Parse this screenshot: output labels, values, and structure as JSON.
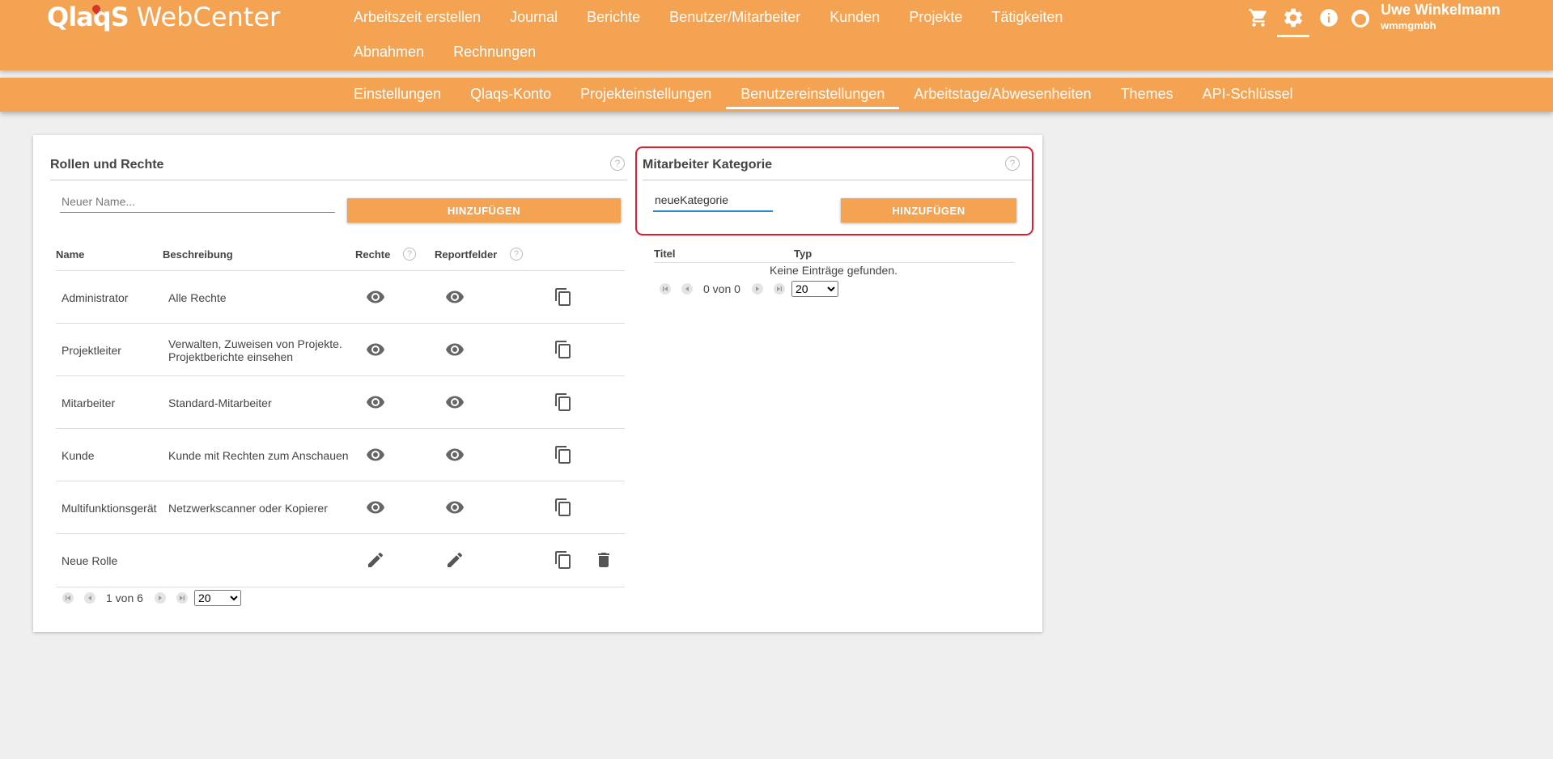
{
  "app": {
    "logo_mark": "QlaqS",
    "logo_text": "WebCenter"
  },
  "main_nav": [
    {
      "label": "Arbeitszeit erstellen"
    },
    {
      "label": "Journal"
    },
    {
      "label": "Berichte"
    },
    {
      "label": "Benutzer/Mitarbeiter"
    },
    {
      "label": "Kunden"
    },
    {
      "label": "Projekte"
    },
    {
      "label": "Tätigkeiten"
    },
    {
      "label": "Abnahmen"
    },
    {
      "label": "Rechnungen"
    }
  ],
  "header_icons": [
    "cart-icon",
    "gear-icon",
    "info-icon",
    "user-avatar-icon"
  ],
  "user": {
    "name": "Uwe Winkelmann",
    "company": "wmmgmbh"
  },
  "sub_nav": [
    {
      "label": "Einstellungen"
    },
    {
      "label": "Qlaqs-Konto"
    },
    {
      "label": "Projekteinstellungen"
    },
    {
      "label": "Benutzereinstellungen",
      "active": true
    },
    {
      "label": "Arbeitstage/Abwesenheiten"
    },
    {
      "label": "Themes"
    },
    {
      "label": "API-Schlüssel"
    }
  ],
  "roles": {
    "title": "Rollen und Rechte",
    "input_placeholder": "Neuer Name...",
    "input_value": "",
    "add_label": "HINZUFÜGEN",
    "columns": {
      "name": "Name",
      "description": "Beschreibung",
      "rights": "Rechte",
      "report_fields": "Reportfelder"
    },
    "rows": [
      {
        "name": "Administrator",
        "description": "Alle Rechte",
        "mode": "view",
        "deletable": false
      },
      {
        "name": "Projektleiter",
        "description": "Verwalten, Zuweisen von Projekte. Projektberichte einsehen",
        "mode": "view",
        "deletable": false
      },
      {
        "name": "Mitarbeiter",
        "description": "Standard-Mitarbeiter",
        "mode": "view",
        "deletable": false
      },
      {
        "name": "Kunde",
        "description": "Kunde mit Rechten zum Anschauen",
        "mode": "view",
        "deletable": false
      },
      {
        "name": "Multifunktionsgerät",
        "description": "Netzwerkscanner oder Kopierer",
        "mode": "view",
        "deletable": false
      },
      {
        "name": "Neue Rolle",
        "description": "",
        "mode": "edit",
        "deletable": true
      }
    ],
    "pager": {
      "text": "1 von 6",
      "page_size": "20",
      "page_size_options": [
        "20"
      ]
    }
  },
  "categories": {
    "title": "Mitarbeiter Kategorie",
    "input_value": "neueKategorie",
    "add_label": "HINZUFÜGEN",
    "columns": {
      "title": "Titel",
      "type": "Typ"
    },
    "empty_text": "Keine Einträge gefunden.",
    "pager": {
      "text": "0 von 0",
      "page_size": "20",
      "page_size_options": [
        "20"
      ]
    }
  },
  "colors": {
    "accent": "#f4a352",
    "highlight": "#e01e2b",
    "focus": "#2f86c8"
  }
}
